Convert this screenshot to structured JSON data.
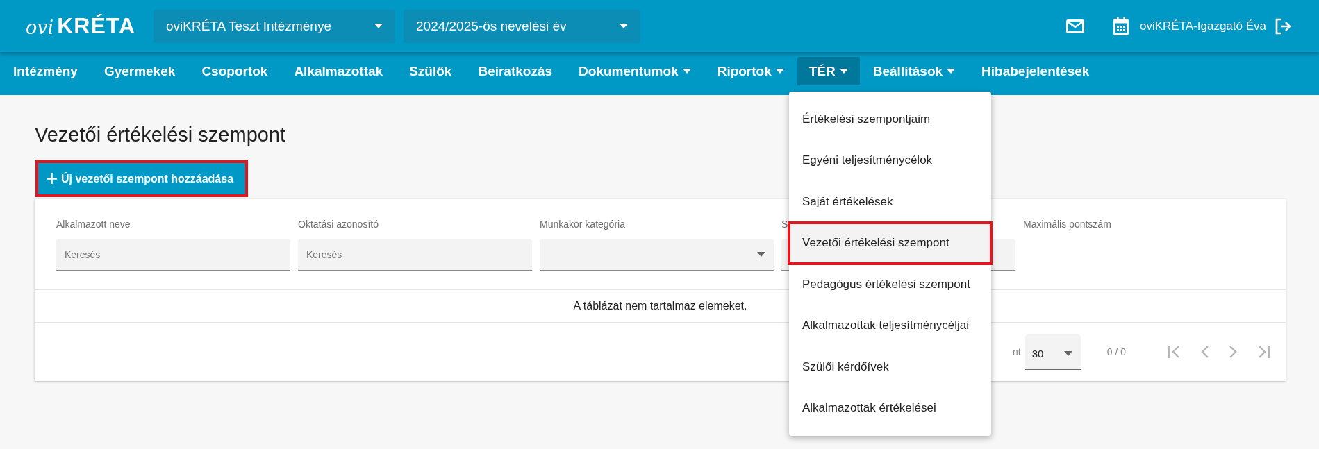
{
  "header": {
    "logo_prefix": "ovi",
    "logo_name": "KRÉTA",
    "institution": "oviKRÉTA Teszt Intézménye",
    "year": "2024/2025-ös nevelési év",
    "user": "oviKRÉTA-Igazgató Éva"
  },
  "nav": [
    {
      "label": "Intézmény",
      "dropdown": false,
      "selected": false
    },
    {
      "label": "Gyermekek",
      "dropdown": false,
      "selected": false
    },
    {
      "label": "Csoportok",
      "dropdown": false,
      "selected": false
    },
    {
      "label": "Alkalmazottak",
      "dropdown": false,
      "selected": false
    },
    {
      "label": "Szülők",
      "dropdown": false,
      "selected": false
    },
    {
      "label": "Beiratkozás",
      "dropdown": false,
      "selected": false
    },
    {
      "label": "Dokumentumok",
      "dropdown": true,
      "selected": false
    },
    {
      "label": "Riportok",
      "dropdown": true,
      "selected": false
    },
    {
      "label": "TÉR",
      "dropdown": true,
      "selected": true
    },
    {
      "label": "Beállítások",
      "dropdown": true,
      "selected": false
    },
    {
      "label": "Hibabejelentések",
      "dropdown": false,
      "selected": false
    }
  ],
  "menu": [
    {
      "label": "Értékelési szempontjaim",
      "selected": false,
      "annotated": false
    },
    {
      "label": "Egyéni teljesítménycélok",
      "selected": false,
      "annotated": false
    },
    {
      "label": "Saját értékelések",
      "selected": false,
      "annotated": false
    },
    {
      "label": "Vezetői értékelési szempont",
      "selected": true,
      "annotated": true
    },
    {
      "label": "Pedagógus értékelési szempont",
      "selected": false,
      "annotated": false
    },
    {
      "label": "Alkalmazottak teljesítménycéljai",
      "selected": false,
      "annotated": false
    },
    {
      "label": "Szülői kérdőívek",
      "selected": false,
      "annotated": false
    },
    {
      "label": "Alkalmazottak értékelései",
      "selected": false,
      "annotated": false
    }
  ],
  "page": {
    "title": "Vezetői értékelési szempont",
    "add_button": {
      "label": "Új vezetői szempont hozzáadása",
      "annotated": true
    }
  },
  "table": {
    "columns": [
      {
        "heading": "Alkalmazott neve",
        "kind": "search",
        "placeholder": "Keresés"
      },
      {
        "heading": "Oktatási azonosító",
        "kind": "search",
        "placeholder": "Keresés"
      },
      {
        "heading": "Munkakör kategória",
        "kind": "select"
      },
      {
        "heading": "S",
        "kind": "search"
      },
      {
        "heading": "Maximális pontszám",
        "kind": "none"
      }
    ],
    "empty_message": "A táblázat nem tartalmaz elemeket.",
    "pager": {
      "label": "nt",
      "page_size": "30",
      "range": "0 / 0"
    }
  }
}
